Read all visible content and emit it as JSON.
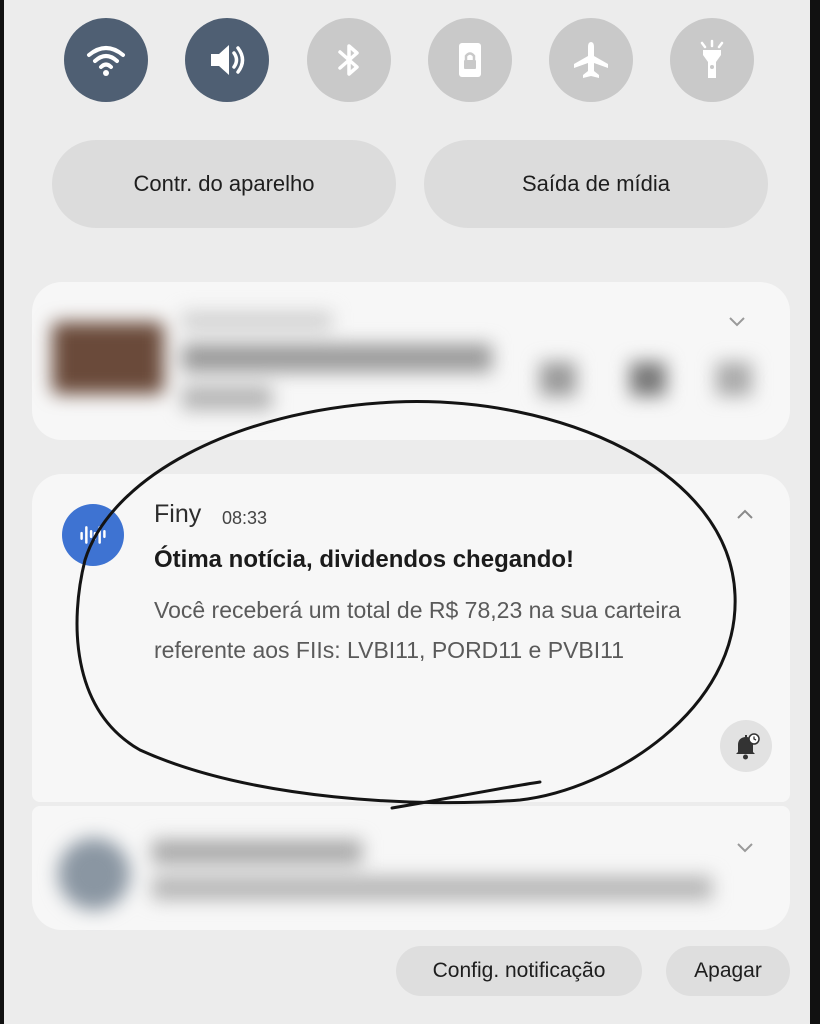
{
  "quick_toggles": [
    {
      "name": "wifi-icon",
      "state": "on"
    },
    {
      "name": "sound-icon",
      "state": "on"
    },
    {
      "name": "bluetooth-icon",
      "state": "off"
    },
    {
      "name": "screen-lock-icon",
      "state": "off"
    },
    {
      "name": "airplane-icon",
      "state": "off"
    },
    {
      "name": "flashlight-icon",
      "state": "off"
    }
  ],
  "shortcuts": {
    "device_control": "Contr. do aparelho",
    "media_output": "Saída de mídia"
  },
  "notification": {
    "app_name": "Finy",
    "time": "08:33",
    "title": "Ótima notícia, dividendos chegando!",
    "body": "Você receberá um total de R$ 78,23 na sua carteira referente aos FIIs: LVBI11, PORD11 e PVBI11",
    "app_color": "#3e73d2"
  },
  "footer": {
    "settings_label": "Config. notificação",
    "clear_label": "Apagar"
  },
  "colors": {
    "toggle_on": "#4f5f73",
    "toggle_off": "#c9c9c9",
    "background": "#ececec",
    "card": "#f7f7f7"
  }
}
